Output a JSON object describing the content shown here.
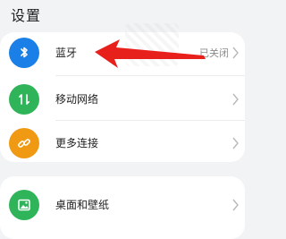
{
  "header": {
    "title": "设置"
  },
  "items": [
    {
      "label": "蓝牙",
      "value": "已关闭",
      "icon": "bluetooth-icon",
      "color": "#1a7fe6"
    },
    {
      "label": "移动网络",
      "value": "",
      "icon": "mobile-network-icon",
      "color": "#2fb45a"
    },
    {
      "label": "更多连接",
      "value": "",
      "icon": "link-icon",
      "color": "#f09a14"
    },
    {
      "label": "桌面和壁纸",
      "value": "",
      "icon": "wallpaper-icon",
      "color": "#2fb45a"
    }
  ],
  "annotation": {
    "color": "#e8201c"
  }
}
